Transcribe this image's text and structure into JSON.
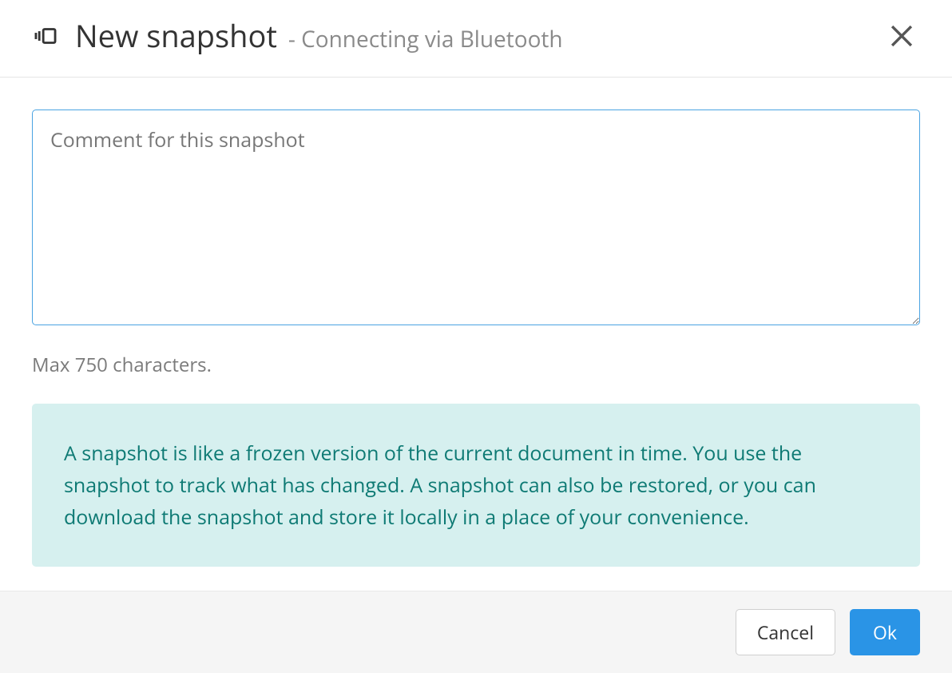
{
  "header": {
    "title": "New snapshot",
    "subtitle": "- Connecting via Bluetooth"
  },
  "body": {
    "comment_placeholder": "Comment for this snapshot",
    "comment_value": "",
    "helper_text": "Max 750 characters.",
    "info_text": "A snapshot is like a frozen version of the current document in time. You use the snapshot to track what has changed. A snapshot can also be restored, or you can download the snapshot and store it locally in a place of your convenience."
  },
  "footer": {
    "cancel_label": "Cancel",
    "ok_label": "Ok"
  }
}
